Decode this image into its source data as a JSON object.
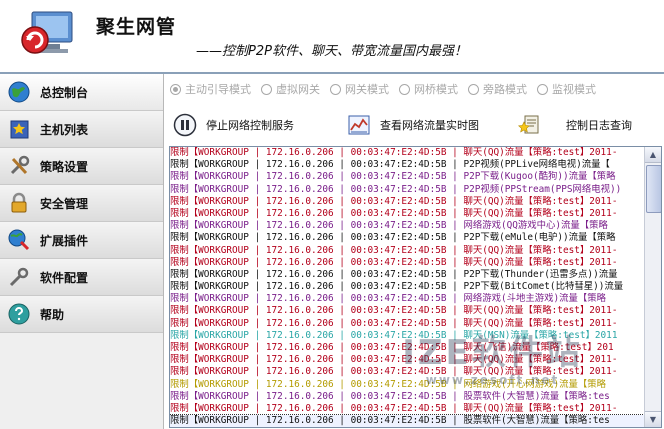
{
  "header": {
    "title": "聚生网管",
    "slogan": "——控制P2P软件、聊天、带宽流量国内最强！"
  },
  "sidebar": {
    "items": [
      {
        "label": "总控制台",
        "icon": "globe-icon",
        "active": true
      },
      {
        "label": "主机列表",
        "icon": "star-list-icon",
        "active": false
      },
      {
        "label": "策略设置",
        "icon": "tools-icon",
        "active": false
      },
      {
        "label": "安全管理",
        "icon": "lock-icon",
        "active": false
      },
      {
        "label": "扩展插件",
        "icon": "globe-gear-icon",
        "active": false
      },
      {
        "label": "软件配置",
        "icon": "wrench-icon",
        "active": false
      },
      {
        "label": "帮助",
        "icon": "help-globe-icon",
        "active": false
      }
    ]
  },
  "modes": [
    {
      "label": "主动引导模式",
      "checked": true
    },
    {
      "label": "虚拟网关",
      "checked": false
    },
    {
      "label": "网关模式",
      "checked": false
    },
    {
      "label": "网桥模式",
      "checked": false
    },
    {
      "label": "旁路模式",
      "checked": false
    },
    {
      "label": "监视模式",
      "checked": false
    }
  ],
  "actions": {
    "stop": {
      "label": "停止网络控制服务",
      "icon": "pause-icon"
    },
    "traffic": {
      "label": "查看网络流量实时图",
      "icon": "chart-icon"
    },
    "log": {
      "label": "控制日志查询",
      "icon": "star-log-icon"
    }
  },
  "watermark": {
    "main": "IZE软件站",
    "sub": "www.zesoft.net"
  },
  "log": {
    "rows": [
      {
        "action": "限制",
        "group": "【WORKGROUP",
        "ip": "172.16.0.206",
        "mac": "00:03:47:E2:4D:5B",
        "desc": "聊天(QQ)流量【策略:test】2011-",
        "color": "red"
      },
      {
        "action": "限制",
        "group": "【WORKGROUP",
        "ip": "172.16.0.206",
        "mac": "00:03:47:E2:4D:5B",
        "desc": "P2P视频(PPLive网络电视)流量【",
        "color": "black"
      },
      {
        "action": "限制",
        "group": "【WORKGROUP",
        "ip": "172.16.0.206",
        "mac": "00:03:47:E2:4D:5B",
        "desc": "P2P下载(Kugoo(酷狗))流量【策略",
        "color": "purple"
      },
      {
        "action": "限制",
        "group": "【WORKGROUP",
        "ip": "172.16.0.206",
        "mac": "00:03:47:E2:4D:5B",
        "desc": "P2P视频(PPStream(PPS网络电视))",
        "color": "purple"
      },
      {
        "action": "限制",
        "group": "【WORKGROUP",
        "ip": "172.16.0.206",
        "mac": "00:03:47:E2:4D:5B",
        "desc": "聊天(QQ)流量【策略:test】2011-",
        "color": "red"
      },
      {
        "action": "限制",
        "group": "【WORKGROUP",
        "ip": "172.16.0.206",
        "mac": "00:03:47:E2:4D:5B",
        "desc": "聊天(QQ)流量【策略:test】2011-",
        "color": "red"
      },
      {
        "action": "限制",
        "group": "【WORKGROUP",
        "ip": "172.16.0.206",
        "mac": "00:03:47:E2:4D:5B",
        "desc": "网络游戏(QQ游戏中心)流量【策略",
        "color": "purple"
      },
      {
        "action": "限制",
        "group": "【WORKGROUP",
        "ip": "172.16.0.206",
        "mac": "00:03:47:E2:4D:5B",
        "desc": "P2P下载(eMule(电驴))流量【策略",
        "color": "black"
      },
      {
        "action": "限制",
        "group": "【WORKGROUP",
        "ip": "172.16.0.206",
        "mac": "00:03:47:E2:4D:5B",
        "desc": "聊天(QQ)流量【策略:test】2011-",
        "color": "red"
      },
      {
        "action": "限制",
        "group": "【WORKGROUP",
        "ip": "172.16.0.206",
        "mac": "00:03:47:E2:4D:5B",
        "desc": "聊天(QQ)流量【策略:test】2011-",
        "color": "red"
      },
      {
        "action": "限制",
        "group": "【WORKGROUP",
        "ip": "172.16.0.206",
        "mac": "00:03:47:E2:4D:5B",
        "desc": "P2P下载(Thunder(迅雷多点))流量",
        "color": "black"
      },
      {
        "action": "限制",
        "group": "【WORKGROUP",
        "ip": "172.16.0.206",
        "mac": "00:03:47:E2:4D:5B",
        "desc": "P2P下载(BitComet(比特彗星))流量",
        "color": "black"
      },
      {
        "action": "限制",
        "group": "【WORKGROUP",
        "ip": "172.16.0.206",
        "mac": "00:03:47:E2:4D:5B",
        "desc": "网络游戏(斗地主游戏)流量【策略",
        "color": "purple"
      },
      {
        "action": "限制",
        "group": "【WORKGROUP",
        "ip": "172.16.0.206",
        "mac": "00:03:47:E2:4D:5B",
        "desc": "聊天(QQ)流量【策略:test】2011-",
        "color": "red"
      },
      {
        "action": "限制",
        "group": "【WORKGROUP",
        "ip": "172.16.0.206",
        "mac": "00:03:47:E2:4D:5B",
        "desc": "聊天(QQ)流量【策略:test】2011-",
        "color": "red"
      },
      {
        "action": "限制",
        "group": "【WORKGROUP",
        "ip": "172.16.0.206",
        "mac": "00:03:47:E2:4D:5B",
        "desc": "聊天(MSN)流量【策略:test】2011",
        "color": "teal"
      },
      {
        "action": "限制",
        "group": "【WORKGROUP",
        "ip": "172.16.0.206",
        "mac": "00:03:47:E2:4D:5B",
        "desc": "聊天(飞信)流量【策略:test】201",
        "color": "red"
      },
      {
        "action": "限制",
        "group": "【WORKGROUP",
        "ip": "172.16.0.206",
        "mac": "00:03:47:E2:4D:5B",
        "desc": "聊天(QQ)流量【策略:test】2011-",
        "color": "red"
      },
      {
        "action": "限制",
        "group": "【WORKGROUP",
        "ip": "172.16.0.206",
        "mac": "00:03:47:E2:4D:5B",
        "desc": "聊天(QQ)流量【策略:test】2011-",
        "color": "red"
      },
      {
        "action": "限制",
        "group": "【WORKGROUP",
        "ip": "172.16.0.206",
        "mac": "00:03:47:E2:4D:5B",
        "desc": "网络游戏(开心网游戏)流量【策略",
        "color": "gold"
      },
      {
        "action": "限制",
        "group": "【WORKGROUP",
        "ip": "172.16.0.206",
        "mac": "00:03:47:E2:4D:5B",
        "desc": "股票软件(大智慧)流量【策略:tes",
        "color": "purple"
      },
      {
        "action": "限制",
        "group": "【WORKGROUP",
        "ip": "172.16.0.206",
        "mac": "00:03:47:E2:4D:5B",
        "desc": "聊天(QQ)流量【策略:test】2011-",
        "color": "red"
      },
      {
        "action": "限制",
        "group": "【WORKGROUP",
        "ip": "172.16.0.206",
        "mac": "00:03:47:E2:4D:5B",
        "desc": "股票软件(大智慧)流量【策略:tes",
        "color": "black",
        "selected": true
      }
    ]
  }
}
